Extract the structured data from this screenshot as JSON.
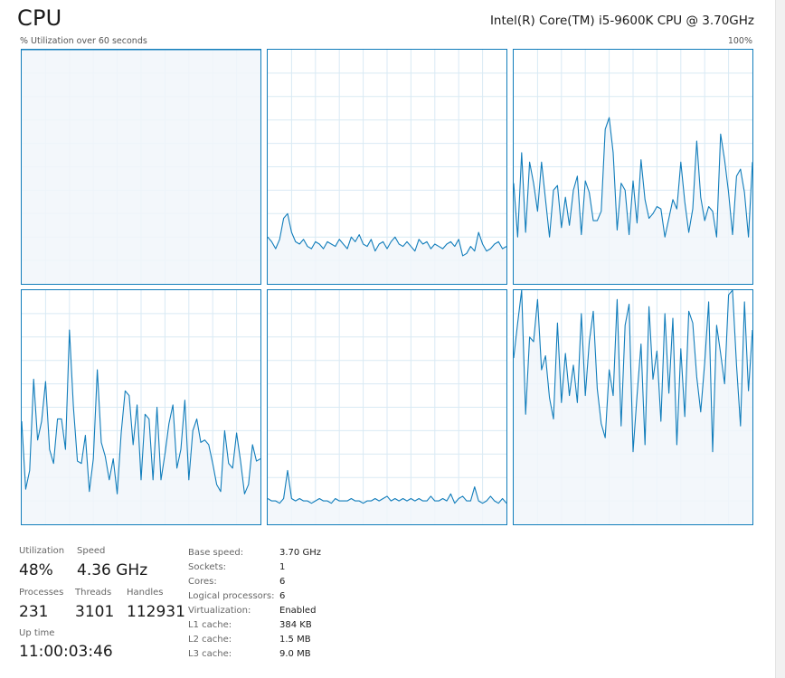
{
  "header": {
    "title": "CPU",
    "cpu_name": "Intel(R) Core(TM) i5-9600K CPU @ 3.70GHz",
    "graph_caption": "% Utilization over 60 seconds",
    "max_label": "100%"
  },
  "colors": {
    "accent": "#117dbb",
    "fill": "#f1f6fa",
    "grid": "#d9eaf4"
  },
  "stats": {
    "utilization_label": "Utilization",
    "utilization_value": "48%",
    "speed_label": "Speed",
    "speed_value": "4.36 GHz",
    "processes_label": "Processes",
    "processes_value": "231",
    "threads_label": "Threads",
    "threads_value": "3101",
    "handles_label": "Handles",
    "handles_value": "112931",
    "uptime_label": "Up time",
    "uptime_value": "11:00:03:46"
  },
  "details": [
    {
      "label": "Base speed:",
      "value": "3.70 GHz"
    },
    {
      "label": "Sockets:",
      "value": "1"
    },
    {
      "label": "Cores:",
      "value": "6"
    },
    {
      "label": "Logical processors:",
      "value": "6"
    },
    {
      "label": "Virtualization:",
      "value": "Enabled"
    },
    {
      "label": "L1 cache:",
      "value": "384 KB"
    },
    {
      "label": "L2 cache:",
      "value": "1.5 MB"
    },
    {
      "label": "L3 cache:",
      "value": "9.0 MB"
    }
  ],
  "chart_data": {
    "type": "area",
    "ylim": [
      0,
      100
    ],
    "x_range_seconds": 60,
    "series": [
      {
        "values": [
          100,
          100,
          100,
          100,
          100,
          100,
          100,
          100,
          100,
          100,
          100,
          100,
          100,
          100,
          100,
          100,
          100,
          100,
          100,
          100,
          100,
          100,
          100,
          100,
          100,
          100,
          100,
          100,
          100,
          100,
          100,
          100,
          100,
          100,
          100,
          100,
          100,
          100,
          100,
          100,
          100,
          100,
          100,
          100,
          100,
          100,
          100,
          100,
          100,
          100,
          100,
          100,
          100,
          100,
          100,
          100,
          100,
          100,
          100,
          100,
          100
        ]
      },
      {
        "values": [
          20,
          18,
          15,
          19,
          28,
          30,
          22,
          18,
          17,
          19,
          16,
          15,
          18,
          17,
          15,
          18,
          17,
          16,
          19,
          17,
          15,
          20,
          18,
          21,
          17,
          16,
          19,
          14,
          17,
          18,
          15,
          18,
          20,
          17,
          16,
          18,
          16,
          14,
          19,
          17,
          18,
          15,
          17,
          16,
          15,
          17,
          18,
          16,
          19,
          12,
          13,
          16,
          14,
          22,
          17,
          14,
          15,
          17,
          18,
          15,
          16
        ]
      },
      {
        "values": [
          43,
          20,
          56,
          22,
          52,
          43,
          31,
          52,
          36,
          20,
          40,
          42,
          24,
          37,
          25,
          40,
          46,
          21,
          44,
          39,
          27,
          27,
          31,
          66,
          71,
          56,
          23,
          43,
          40,
          21,
          44,
          26,
          53,
          36,
          28,
          30,
          33,
          32,
          20,
          28,
          36,
          32,
          52,
          35,
          22,
          32,
          61,
          37,
          27,
          33,
          31,
          20,
          64,
          53,
          39,
          21,
          46,
          49,
          39,
          20,
          52
        ]
      },
      {
        "values": [
          44,
          15,
          23,
          62,
          36,
          44,
          61,
          32,
          26,
          45,
          45,
          32,
          83,
          50,
          27,
          26,
          38,
          14,
          28,
          66,
          35,
          29,
          19,
          28,
          13,
          39,
          57,
          55,
          34,
          51,
          19,
          47,
          45,
          19,
          50,
          19,
          30,
          43,
          51,
          24,
          32,
          53,
          19,
          40,
          45,
          35,
          36,
          34,
          26,
          17,
          14,
          40,
          26,
          24,
          39,
          27,
          13,
          17,
          34,
          27,
          28
        ]
      },
      {
        "values": [
          11,
          10,
          10,
          9,
          11,
          23,
          11,
          10,
          11,
          10,
          10,
          9,
          10,
          11,
          10,
          10,
          9,
          11,
          10,
          10,
          10,
          11,
          10,
          10,
          9,
          10,
          10,
          11,
          10,
          11,
          12,
          10,
          11,
          10,
          11,
          10,
          11,
          10,
          11,
          10,
          10,
          12,
          10,
          10,
          11,
          10,
          13,
          9,
          11,
          12,
          10,
          10,
          16,
          10,
          9,
          10,
          12,
          10,
          9,
          11,
          9
        ]
      },
      {
        "values": [
          71,
          86,
          100,
          47,
          80,
          78,
          96,
          66,
          72,
          54,
          45,
          86,
          52,
          73,
          55,
          68,
          52,
          90,
          55,
          78,
          91,
          58,
          43,
          37,
          66,
          55,
          96,
          42,
          85,
          94,
          31,
          55,
          77,
          34,
          93,
          62,
          74,
          44,
          90,
          56,
          88,
          34,
          75,
          46,
          91,
          86,
          63,
          48,
          69,
          95,
          31,
          85,
          73,
          60,
          98,
          100,
          68,
          42,
          95,
          57,
          83
        ]
      }
    ]
  }
}
